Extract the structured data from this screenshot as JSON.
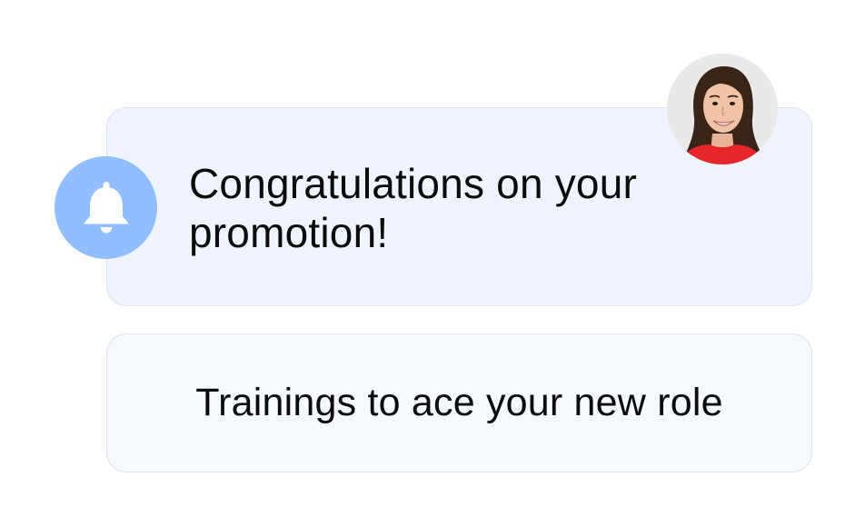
{
  "notification": {
    "message": "Congratulations on your promotion!",
    "icon": "bell-icon",
    "avatar": "user-avatar"
  },
  "action": {
    "label": "Trainings to ace your new role"
  },
  "colors": {
    "bell_badge": "#91beff",
    "card_primary_bg": "#eff4fe",
    "card_secondary_bg": "#f6f9fe",
    "card_border": "#dfe3ea",
    "text": "#0c0c0c"
  }
}
